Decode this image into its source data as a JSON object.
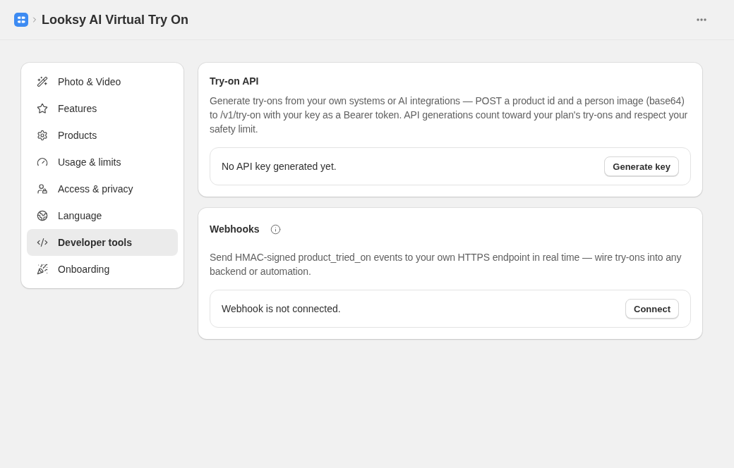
{
  "header": {
    "title": "Looksy AI Virtual Try On"
  },
  "sidebar": {
    "items": [
      {
        "label": "Photo & Video",
        "selected": false
      },
      {
        "label": "Features",
        "selected": false
      },
      {
        "label": "Products",
        "selected": false
      },
      {
        "label": "Usage & limits",
        "selected": false
      },
      {
        "label": "Access & privacy",
        "selected": false
      },
      {
        "label": "Language",
        "selected": false
      },
      {
        "label": "Developer tools",
        "selected": true
      },
      {
        "label": "Onboarding",
        "selected": false
      }
    ]
  },
  "sections": [
    {
      "title": "Try-on API",
      "info": false,
      "description": "Generate try-ons from your own systems or AI integrations — POST a product id and a person image (base64) to /v1/try-on with your key as a Bearer token. API generations count toward your plan's try-ons and respect your safety limit.",
      "status": "No API key generated yet.",
      "action": "Generate key"
    },
    {
      "title": "Webhooks",
      "info": true,
      "description": "Send HMAC-signed product_tried_on events to your own HTTPS endpoint in real time — wire try-ons into any backend or automation.",
      "status": "Webhook is not connected.",
      "action": "Connect"
    }
  ]
}
